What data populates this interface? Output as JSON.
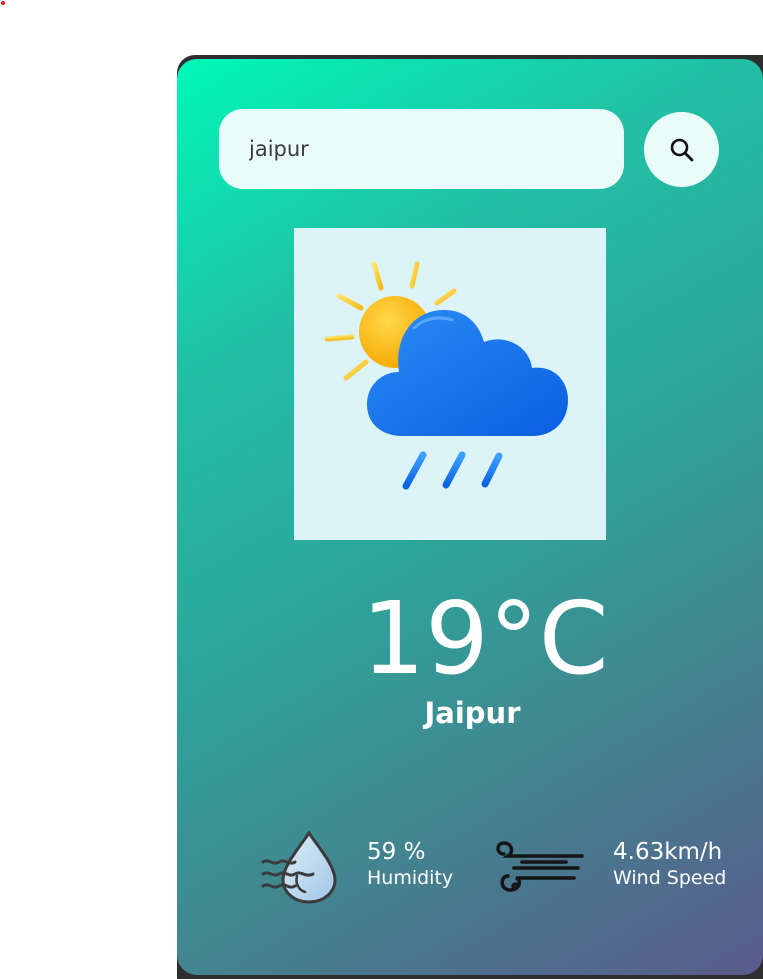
{
  "search": {
    "value": "jaipur",
    "icon": "search-icon"
  },
  "weather": {
    "icon": "sun-cloud-rain-icon",
    "temperature": "19°C",
    "city": "Jaipur"
  },
  "details": {
    "humidity": {
      "icon": "humidity-icon",
      "value": "59 %",
      "label": "Humidity"
    },
    "wind": {
      "icon": "wind-icon",
      "value": "4.63km/h",
      "label": "Wind Speed"
    }
  },
  "colors": {
    "gradient_start": "#00f8b8",
    "gradient_end": "#5a5a8c",
    "input_bg": "#e9fcfa",
    "image_bg": "#dcf3f7",
    "text": "#ffffff"
  }
}
